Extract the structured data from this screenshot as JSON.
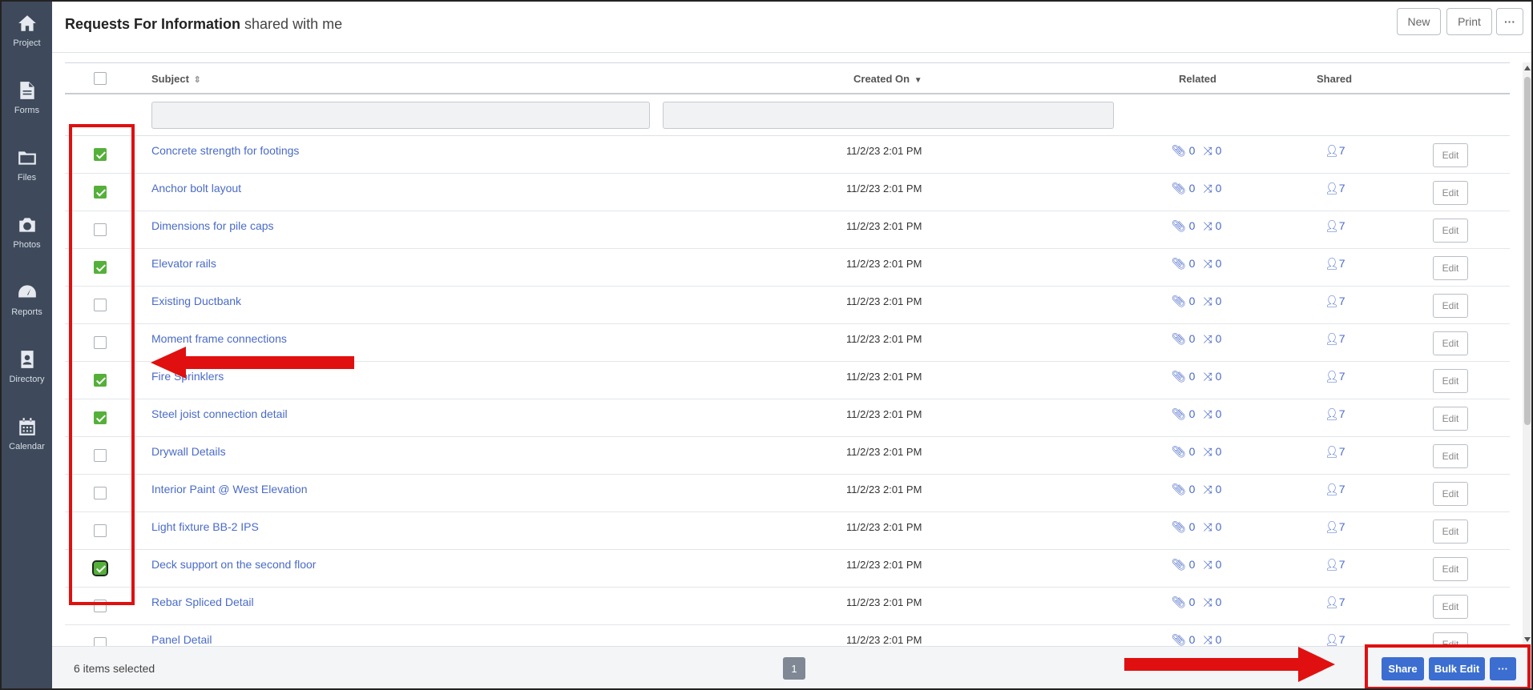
{
  "sidebar": {
    "items": [
      {
        "label": "Project",
        "icon": "home-icon"
      },
      {
        "label": "Forms",
        "icon": "document-icon"
      },
      {
        "label": "Files",
        "icon": "folder-icon"
      },
      {
        "label": "Photos",
        "icon": "camera-icon"
      },
      {
        "label": "Reports",
        "icon": "dashboard-icon"
      },
      {
        "label": "Directory",
        "icon": "address-book-icon"
      },
      {
        "label": "Calendar",
        "icon": "calendar-icon"
      }
    ]
  },
  "header": {
    "title": "Requests For Information",
    "subtitle": "shared with me",
    "new_label": "New",
    "print_label": "Print",
    "more_label": "···"
  },
  "table": {
    "columns": {
      "subject": "Subject",
      "subject_sort_icon": "sort-icon",
      "created_on": "Created On",
      "created_sort_icon": "sort-desc-icon",
      "related": "Related",
      "shared": "Shared"
    },
    "rows": [
      {
        "checked": true,
        "subject": "Concrete strength for footings",
        "created": "11/2/23 2:01 PM",
        "attachments": "0",
        "links": "0",
        "shared": "7",
        "edit": "Edit"
      },
      {
        "checked": true,
        "subject": "Anchor bolt layout",
        "created": "11/2/23 2:01 PM",
        "attachments": "0",
        "links": "0",
        "shared": "7",
        "edit": "Edit"
      },
      {
        "checked": false,
        "subject": "Dimensions for pile caps",
        "created": "11/2/23 2:01 PM",
        "attachments": "0",
        "links": "0",
        "shared": "7",
        "edit": "Edit"
      },
      {
        "checked": true,
        "subject": "Elevator rails",
        "created": "11/2/23 2:01 PM",
        "attachments": "0",
        "links": "0",
        "shared": "7",
        "edit": "Edit"
      },
      {
        "checked": false,
        "subject": "Existing Ductbank",
        "created": "11/2/23 2:01 PM",
        "attachments": "0",
        "links": "0",
        "shared": "7",
        "edit": "Edit"
      },
      {
        "checked": false,
        "subject": "Moment frame connections",
        "created": "11/2/23 2:01 PM",
        "attachments": "0",
        "links": "0",
        "shared": "7",
        "edit": "Edit"
      },
      {
        "checked": true,
        "subject": "Fire Sprinklers",
        "created": "11/2/23 2:01 PM",
        "attachments": "0",
        "links": "0",
        "shared": "7",
        "edit": "Edit"
      },
      {
        "checked": true,
        "subject": "Steel joist connection detail",
        "created": "11/2/23 2:01 PM",
        "attachments": "0",
        "links": "0",
        "shared": "7",
        "edit": "Edit"
      },
      {
        "checked": false,
        "subject": "Drywall Details",
        "created": "11/2/23 2:01 PM",
        "attachments": "0",
        "links": "0",
        "shared": "7",
        "edit": "Edit"
      },
      {
        "checked": false,
        "subject": "Interior Paint @ West Elevation",
        "created": "11/2/23 2:01 PM",
        "attachments": "0",
        "links": "0",
        "shared": "7",
        "edit": "Edit"
      },
      {
        "checked": false,
        "subject": "Light fixture BB-2 IPS",
        "created": "11/2/23 2:01 PM",
        "attachments": "0",
        "links": "0",
        "shared": "7",
        "edit": "Edit"
      },
      {
        "checked": true,
        "subject": "Deck support on the second floor",
        "created": "11/2/23 2:01 PM",
        "attachments": "0",
        "links": "0",
        "shared": "7",
        "edit": "Edit",
        "focused": true
      },
      {
        "checked": false,
        "subject": "Rebar Spliced Detail",
        "created": "11/2/23 2:01 PM",
        "attachments": "0",
        "links": "0",
        "shared": "7",
        "edit": "Edit"
      },
      {
        "checked": false,
        "subject": "Panel Detail",
        "created": "11/2/23 2:01 PM",
        "attachments": "0",
        "links": "0",
        "shared": "7",
        "edit": "Edit"
      }
    ]
  },
  "footer": {
    "selected_text": "6 items selected",
    "page": "1",
    "share_label": "Share",
    "bulk_edit_label": "Bulk Edit",
    "more_label": "···"
  },
  "colors": {
    "sidebar": "#3e4a5b",
    "link": "#4a6bc8",
    "checked": "#55b03a",
    "primary_button": "#3b6ed0",
    "annotation": "#e01010"
  }
}
